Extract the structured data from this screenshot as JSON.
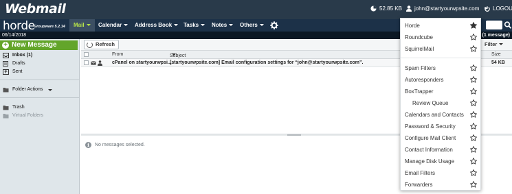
{
  "cpanel_bar": {
    "logo": "Webmail",
    "disk_usage": "52.85 KB",
    "user": "john@startyourwpsite.com",
    "logout": "LOGOUT"
  },
  "horde_bar": {
    "logo": "horde",
    "edition": "Groupware 5.2.14",
    "nav": [
      {
        "label": "Mail",
        "active": true
      },
      {
        "label": "Calendar",
        "active": false
      },
      {
        "label": "Address Book",
        "active": false
      },
      {
        "label": "Tasks",
        "active": false
      },
      {
        "label": "Notes",
        "active": false
      },
      {
        "label": "Others",
        "active": false
      }
    ],
    "settings_icon": "gear-icon",
    "search_icon": "search-icon"
  },
  "date_bar": {
    "date": "06/14/2018",
    "message_count": "(1 message)"
  },
  "sidebar": {
    "new_message": "New Message",
    "folders": [
      {
        "label": "Inbox (1)",
        "icon": "inbox-icon",
        "bold": true
      },
      {
        "label": "Drafts",
        "icon": "drafts-icon",
        "bold": false
      },
      {
        "label": "Sent",
        "icon": "sent-icon",
        "bold": false
      }
    ],
    "folder_actions": "Folder Actions",
    "trash": "Trash",
    "virtual_folders": "Virtual Folders"
  },
  "toolbar": {
    "refresh": "Refresh",
    "filter": "Filter"
  },
  "message_list": {
    "columns": {
      "from": "From",
      "subject": "Subject",
      "size": "Size"
    },
    "rows": [
      {
        "from": "cPanel on startyourwpsi...",
        "subject": "[startyourwpsite.com] Email configuration settings for “john@startyourwpsite.com”.",
        "size": "54 KB"
      }
    ]
  },
  "preview": {
    "empty_text": "No messages selected."
  },
  "apps_menu": {
    "groups": [
      [
        {
          "label": "Horde",
          "starred": true
        },
        {
          "label": "Roundcube",
          "starred": false
        },
        {
          "label": "SquirrelMail",
          "starred": false
        }
      ],
      [
        {
          "label": "Spam Filters",
          "starred": false
        },
        {
          "label": "Autoresponders",
          "starred": false
        },
        {
          "label": "BoxTrapper",
          "starred": false
        },
        {
          "label": "Review Queue",
          "starred": false,
          "indent": true
        },
        {
          "label": "Calendars and Contacts",
          "starred": false
        },
        {
          "label": "Password & Security",
          "starred": false
        },
        {
          "label": "Configure Mail Client",
          "starred": false
        },
        {
          "label": "Contact Information",
          "starred": false
        },
        {
          "label": "Manage Disk Usage",
          "starred": false
        },
        {
          "label": "Email Filters",
          "starred": false
        },
        {
          "label": "Forwarders",
          "starred": false
        }
      ]
    ]
  },
  "colors": {
    "topbar": "#293a4a",
    "navbar": "#1c3148",
    "nav_active_text": "#b6e24a",
    "new_message": "#63a52a",
    "sidebar": "#dfe6ea"
  }
}
